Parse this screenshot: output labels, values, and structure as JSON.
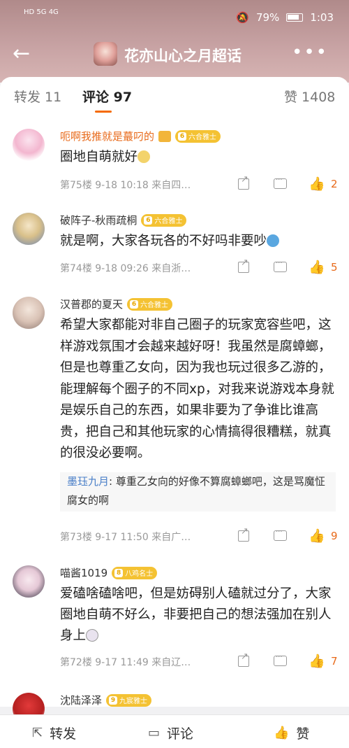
{
  "status_bar": {
    "left_glyphs": "HD 5G 4G",
    "battery": "79%",
    "time": "1:03"
  },
  "header": {
    "title": "花亦山心之月超话"
  },
  "tabs": [
    {
      "label": "转发 11"
    },
    {
      "label": "评论 97"
    },
    {
      "label": "赞 1408"
    }
  ],
  "comments": [
    {
      "username": "呃啊我推就是蕞叼的",
      "badge": "六合雅士",
      "badge_level": "6",
      "text": "圈地自萌就好",
      "meta": "第75楼 9-18 10:18 来自四…",
      "likes": "2"
    },
    {
      "username": "破阵子-秋雨疏桐",
      "badge": "六合雅士",
      "badge_level": "6",
      "text": "就是啊，大家各玩各的不好吗非要吵",
      "meta": "第74楼 9-18 09:26 来自浙…",
      "likes": "5"
    },
    {
      "username": "汉普郡的夏天",
      "badge": "六合雅士",
      "badge_level": "6",
      "text": "希望大家都能对非自己圈子的玩家宽容些吧，这样游戏氛围才会越来越好呀！我虽然是腐蟑螂，但是也尊重乙女向，因为我也玩过很多乙游的，能理解每个圈子的不同xp，对我来说游戏本身就是娱乐自己的东西，如果非要为了争谁比谁高贵，把自己和其他玩家的心情搞得很糟糕，就真的很没必要啊。",
      "reply_name": "墨珏九月",
      "reply_text": ": 尊重乙女向的好像不算腐蟑螂吧，这是骂魔怔腐女的啊",
      "meta": "第73楼 9-17 11:50 来自广…",
      "likes": "9"
    },
    {
      "username": "喵酱1019",
      "badge": "八鸡名士",
      "badge_level": "8",
      "text": "爱磕啥磕啥吧，但是妨碍别人磕就过分了，大家圈地自萌不好么，非要把自己的想法强加在别人身上",
      "meta": "第72楼 9-17 11:49 来自辽…",
      "likes": "7"
    },
    {
      "username": "沈陆泽泽",
      "badge": "九宸雅士",
      "badge_level": "9"
    }
  ],
  "bottom_bar": {
    "repost": "转发",
    "comment": "评论",
    "like": "赞"
  },
  "colors": {
    "accent": "#f56a00",
    "badge": "#f4c233",
    "link": "#4a7fc8"
  }
}
